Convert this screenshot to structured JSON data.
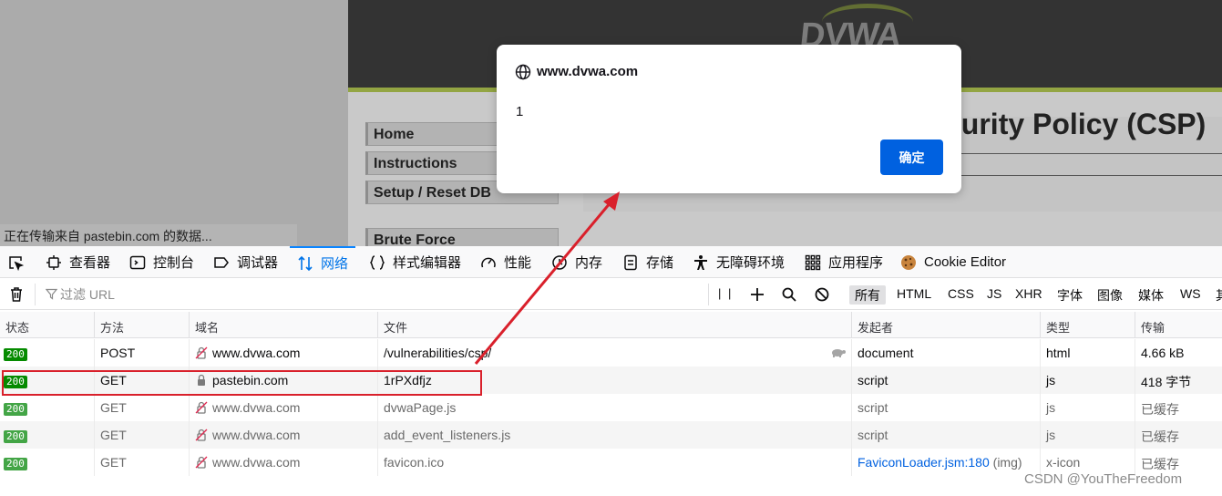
{
  "page": {
    "logo": "DVWA",
    "menu": [
      "Home",
      "Instructions",
      "Setup / Reset DB",
      "Brute Force"
    ],
    "title": "curity Policy (CSP)",
    "status_text": "正在传输来自 pastebin.com 的数据..."
  },
  "dialog": {
    "origin": "www.dvwa.com",
    "message": "1",
    "ok_label": "确定"
  },
  "devtools": {
    "tabs": [
      {
        "label": "查看器",
        "icon": "inspector-icon"
      },
      {
        "label": "控制台",
        "icon": "console-icon"
      },
      {
        "label": "调试器",
        "icon": "debugger-icon"
      },
      {
        "label": "网络",
        "icon": "network-icon",
        "active": true
      },
      {
        "label": "样式编辑器",
        "icon": "style-editor-icon"
      },
      {
        "label": "性能",
        "icon": "performance-icon"
      },
      {
        "label": "内存",
        "icon": "memory-icon"
      },
      {
        "label": "存储",
        "icon": "storage-icon"
      },
      {
        "label": "无障碍环境",
        "icon": "accessibility-icon"
      },
      {
        "label": "应用程序",
        "icon": "application-icon"
      },
      {
        "label": "Cookie Editor",
        "icon": "cookie-icon"
      }
    ],
    "filter_placeholder": "过滤 URL",
    "pause_label": "| |",
    "type_filters": [
      {
        "label": "所有",
        "active": true
      },
      {
        "label": "HTML"
      },
      {
        "label": "CSS"
      },
      {
        "label": "JS"
      },
      {
        "label": "XHR"
      },
      {
        "label": "字体"
      },
      {
        "label": "图像"
      },
      {
        "label": "媒体"
      },
      {
        "label": "WS"
      },
      {
        "label": "其"
      }
    ],
    "columns": [
      "状态",
      "方法",
      "域名",
      "文件",
      "发起者",
      "类型",
      "传输"
    ],
    "requests": [
      {
        "status": "200",
        "method": "POST",
        "domain": "www.dvwa.com",
        "secure": false,
        "file": "/vulnerabilities/csp/",
        "initiator": "document",
        "type": "html",
        "transfer": "4.66 kB"
      },
      {
        "status": "200",
        "method": "GET",
        "domain": "pastebin.com",
        "secure": true,
        "file": "1rPXdfjz",
        "initiator": "script",
        "type": "js",
        "transfer": "418 字节"
      },
      {
        "status": "200",
        "method": "GET",
        "domain": "www.dvwa.com",
        "secure": false,
        "file": "dvwaPage.js",
        "initiator": "script",
        "type": "js",
        "transfer": "已缓存"
      },
      {
        "status": "200",
        "method": "GET",
        "domain": "www.dvwa.com",
        "secure": false,
        "file": "add_event_listeners.js",
        "initiator": "script",
        "type": "js",
        "transfer": "已缓存"
      },
      {
        "status": "200",
        "method": "GET",
        "domain": "www.dvwa.com",
        "secure": false,
        "file": "favicon.ico",
        "initiator_link": "FaviconLoader.jsm:180",
        "initiator_suffix": " (img)",
        "type": "x-icon",
        "transfer": "已缓存"
      }
    ]
  },
  "watermark": "CSDN @YouTheFreedom",
  "colors": {
    "status_ok": "#058b00",
    "status_cached": "#43a546",
    "accent": "#0061e0",
    "annotation": "#d9202b"
  }
}
